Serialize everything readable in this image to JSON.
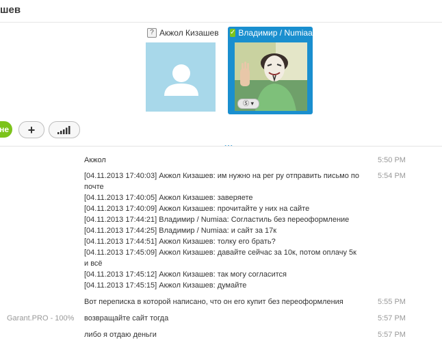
{
  "header": {
    "title": "шев"
  },
  "participants": [
    {
      "name": "Акжол Кизашев",
      "status_icon": "question-status-icon"
    },
    {
      "name": "Владимир / Numiaa",
      "status_icon": "check-status-icon"
    }
  ],
  "toolbar": {
    "call_label": "не",
    "add_label": "+",
    "quality_icon": "signal-bars-icon"
  },
  "more_indicator": "...",
  "zoom_label": "Garant.PRO - 100%",
  "messages": [
    {
      "lines": [
        "Акжол"
      ],
      "time": "5:50 PM"
    },
    {
      "lines": [
        "[04.11.2013 17:40:03] Акжол Кизашев: им нужно на рег ру отправить письмо по",
        "почте",
        "[04.11.2013 17:40:05] Акжол Кизашев: заверяете",
        "[04.11.2013 17:40:09] Акжол Кизашев: прочитайте у них на сайте",
        "[04.11.2013 17:44:21] Владимир / Numiaa: Согластиль без переоформление",
        "[04.11.2013 17:44:25] Владимир / Numiaa: и сайт за 17к",
        "[04.11.2013 17:44:51] Акжол Кизашев: толку его брать?",
        "[04.11.2013 17:45:09] Акжол Кизашев: давайте сейчас за 10к, потом оплачу 5к",
        "и всё",
        "[04.11.2013 17:45:12] Акжол Кизашев: так могу согласится",
        "[04.11.2013 17:45:15] Акжол Кизашев: думайте"
      ],
      "time": "5:54 PM"
    },
    {
      "lines": [
        "Вот переписка в которой написано, что он его купит без переоформления"
      ],
      "time": "5:55 PM"
    },
    {
      "lines": [
        "возвращайте сайт тогда"
      ],
      "time": "5:57 PM"
    },
    {
      "lines": [
        "либо я отдаю деньги"
      ],
      "time": "5:57 PM"
    }
  ]
}
